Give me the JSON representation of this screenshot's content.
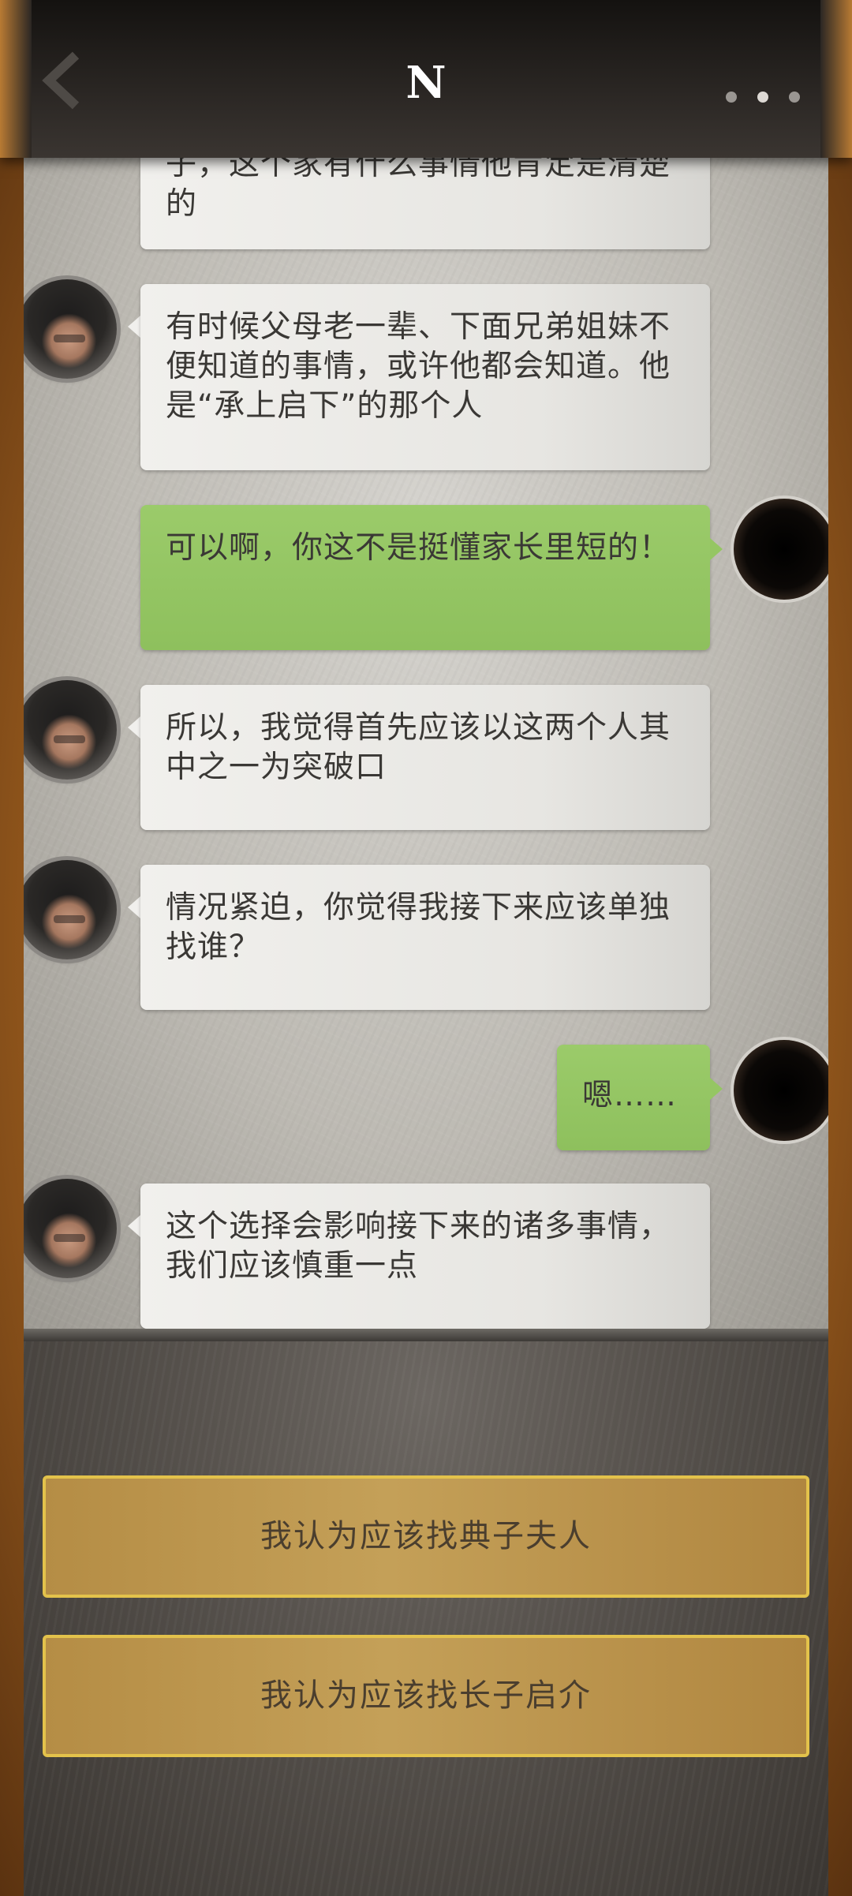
{
  "header": {
    "title": "N",
    "back_icon": "chevron-left-icon",
    "more_icon": "more-dots-icon"
  },
  "messages": [
    {
      "side": "left",
      "text": "子，这个家有什么事情他肯定是清楚的"
    },
    {
      "side": "left",
      "text": "有时候父母老一辈、下面兄弟姐妹不便知道的事情，或许他都会知道。他是“承上启下”的那个人"
    },
    {
      "side": "right",
      "text": "可以啊，你这不是挺懂家长里短的！"
    },
    {
      "side": "left",
      "text": "所以，我觉得首先应该以这两个人其中之一为突破口"
    },
    {
      "side": "left",
      "text": "情况紧迫，你觉得我接下来应该单独找谁？"
    },
    {
      "side": "right",
      "text": "嗯……"
    },
    {
      "side": "left",
      "text": "这个选择会影响接下来的诸多事情，我们应该慎重一点"
    }
  ],
  "choices": [
    {
      "label": "我认为应该找典子夫人"
    },
    {
      "label": "我认为应该找长子启介"
    }
  ],
  "colors": {
    "frame": "#b07233",
    "bubble_white": "#ecebe7",
    "bubble_green": "#95c663",
    "choice_border": "#e3c24b",
    "choice_fill": "#c09a52"
  }
}
